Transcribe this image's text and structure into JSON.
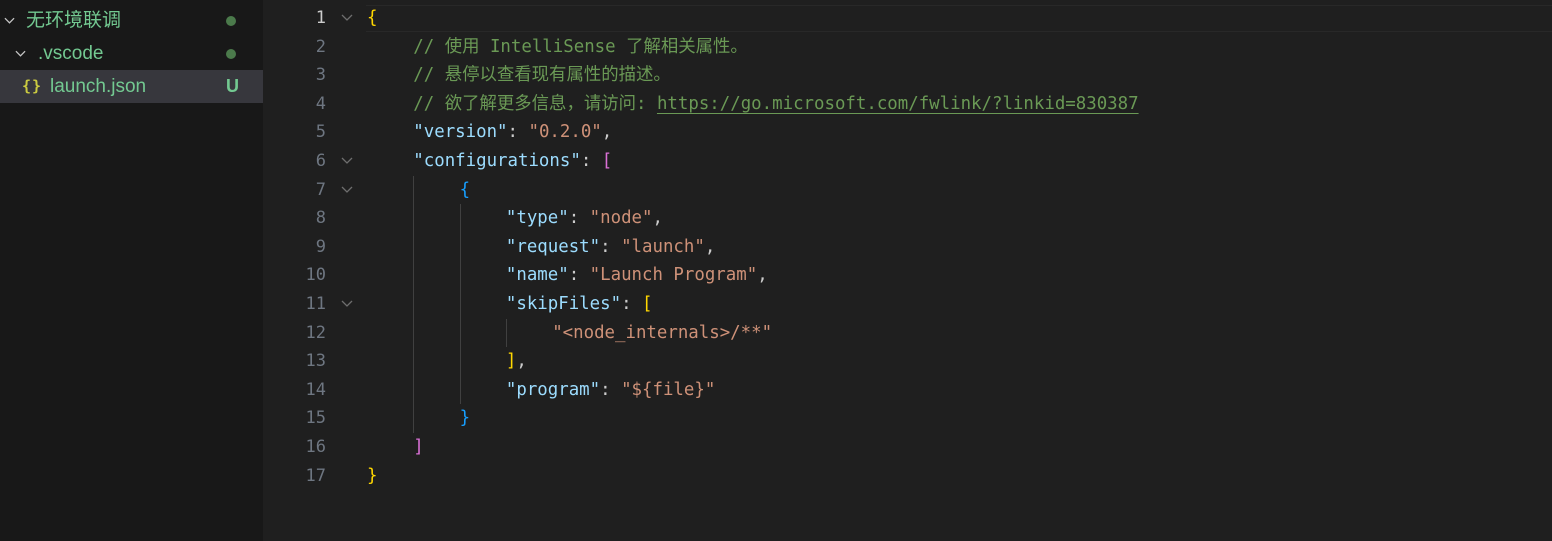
{
  "explorer": {
    "items": [
      {
        "label": "无环境联调",
        "decoration": "dot"
      },
      {
        "label": ".vscode",
        "decoration": "dot"
      },
      {
        "label": "launch.json",
        "icon_text": "{}",
        "badge": "U"
      }
    ]
  },
  "editor": {
    "active_line": 1,
    "line_numbers": [
      "1",
      "2",
      "3",
      "4",
      "5",
      "6",
      "7",
      "8",
      "9",
      "10",
      "11",
      "12",
      "13",
      "14",
      "15",
      "16",
      "17"
    ],
    "lines": [
      {
        "indent": 0,
        "tokens": [
          {
            "t": "{",
            "c": "b-gold"
          }
        ]
      },
      {
        "indent": 1,
        "tokens": [
          {
            "t": "// 使用 IntelliSense 了解相关属性。",
            "c": "tok-com"
          }
        ]
      },
      {
        "indent": 1,
        "tokens": [
          {
            "t": "// 悬停以查看现有属性的描述。",
            "c": "tok-com"
          }
        ]
      },
      {
        "indent": 1,
        "tokens": [
          {
            "t": "// 欲了解更多信息，请访问: ",
            "c": "tok-com"
          },
          {
            "t": "https://go.microsoft.com/fwlink/?linkid=830387",
            "c": "tok-link"
          }
        ]
      },
      {
        "indent": 1,
        "tokens": [
          {
            "t": "\"version\"",
            "c": "tok-key"
          },
          {
            "t": ": ",
            "c": "tok-punc"
          },
          {
            "t": "\"0.2.0\"",
            "c": "tok-str"
          },
          {
            "t": ",",
            "c": "tok-punc"
          }
        ]
      },
      {
        "indent": 1,
        "tokens": [
          {
            "t": "\"configurations\"",
            "c": "tok-key"
          },
          {
            "t": ": ",
            "c": "tok-punc"
          },
          {
            "t": "[",
            "c": "b-pink"
          }
        ]
      },
      {
        "indent": 2,
        "tokens": [
          {
            "t": "{",
            "c": "b-blue"
          }
        ]
      },
      {
        "indent": 3,
        "tokens": [
          {
            "t": "\"type\"",
            "c": "tok-key"
          },
          {
            "t": ": ",
            "c": "tok-punc"
          },
          {
            "t": "\"node\"",
            "c": "tok-str"
          },
          {
            "t": ",",
            "c": "tok-punc"
          }
        ]
      },
      {
        "indent": 3,
        "tokens": [
          {
            "t": "\"request\"",
            "c": "tok-key"
          },
          {
            "t": ": ",
            "c": "tok-punc"
          },
          {
            "t": "\"launch\"",
            "c": "tok-str"
          },
          {
            "t": ",",
            "c": "tok-punc"
          }
        ]
      },
      {
        "indent": 3,
        "tokens": [
          {
            "t": "\"name\"",
            "c": "tok-key"
          },
          {
            "t": ": ",
            "c": "tok-punc"
          },
          {
            "t": "\"Launch Program\"",
            "c": "tok-str"
          },
          {
            "t": ",",
            "c": "tok-punc"
          }
        ]
      },
      {
        "indent": 3,
        "tokens": [
          {
            "t": "\"skipFiles\"",
            "c": "tok-key"
          },
          {
            "t": ": ",
            "c": "tok-punc"
          },
          {
            "t": "[",
            "c": "b-gold"
          }
        ]
      },
      {
        "indent": 4,
        "tokens": [
          {
            "t": "\"<node_internals>/**\"",
            "c": "tok-str"
          }
        ]
      },
      {
        "indent": 3,
        "tokens": [
          {
            "t": "]",
            "c": "b-gold"
          },
          {
            "t": ",",
            "c": "tok-punc"
          }
        ]
      },
      {
        "indent": 3,
        "tokens": [
          {
            "t": "\"program\"",
            "c": "tok-key"
          },
          {
            "t": ": ",
            "c": "tok-punc"
          },
          {
            "t": "\"${file}\"",
            "c": "tok-str"
          }
        ]
      },
      {
        "indent": 2,
        "tokens": [
          {
            "t": "}",
            "c": "b-blue"
          }
        ]
      },
      {
        "indent": 1,
        "tokens": [
          {
            "t": "]",
            "c": "b-pink"
          }
        ]
      },
      {
        "indent": 0,
        "tokens": [
          {
            "t": "}",
            "c": "b-gold"
          }
        ]
      }
    ],
    "foldable_lines": [
      1,
      6,
      7,
      11
    ]
  },
  "colors": {
    "folder_label": "#73c991",
    "untracked_badge": "#73c991",
    "json_icon": "#cbcb41",
    "editor_bg": "#1f1f1f",
    "sidebar_bg": "#181818"
  },
  "icons": {
    "folder_chevron": "chevron-down-icon",
    "fold_chevron": "chevron-down-icon",
    "file_icon": "json-icon"
  }
}
